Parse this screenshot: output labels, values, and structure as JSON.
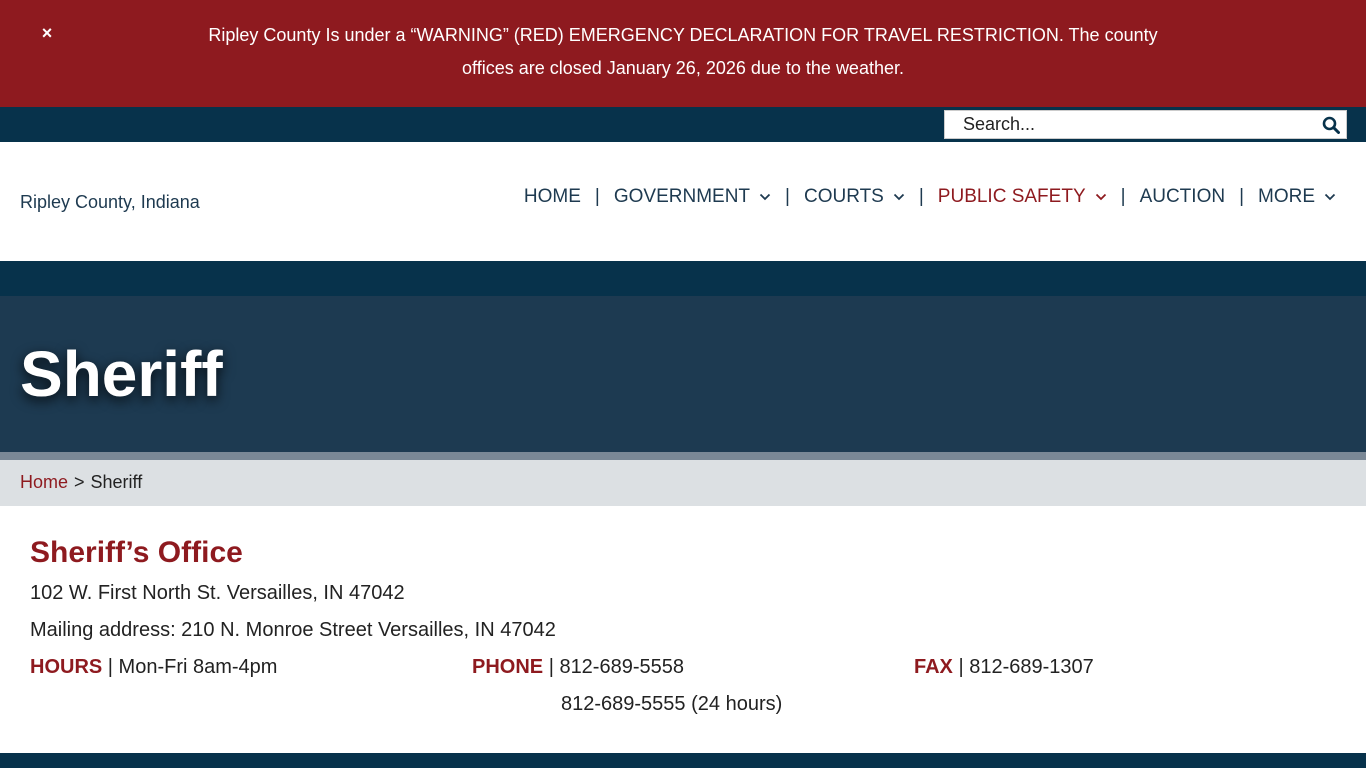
{
  "alert": {
    "close_label": "×",
    "message": "Ripley County Is under a “WARNING” (RED) EMERGENCY DECLARATION FOR TRAVEL RESTRICTION. The county offices are closed January 26, 2026 due to the weather."
  },
  "search": {
    "placeholder": "Search...",
    "icon": "search-icon"
  },
  "logo": {
    "alt": "Ripley County, Indiana"
  },
  "nav": {
    "items": [
      {
        "label": "HOME",
        "dropdown": false
      },
      {
        "label": "GOVERNMENT",
        "dropdown": true
      },
      {
        "label": "COURTS",
        "dropdown": true
      },
      {
        "label": "PUBLIC SAFETY",
        "dropdown": true,
        "active": true
      },
      {
        "label": "AUCTION",
        "dropdown": false
      },
      {
        "label": "MORE",
        "dropdown": true
      }
    ],
    "separator": "|"
  },
  "hero": {
    "title": "Sheriff"
  },
  "breadcrumb": {
    "home": "Home",
    "separator": ">",
    "current": "Sheriff"
  },
  "office": {
    "title": "Sheriff’s Office",
    "address": "102 W. First North St. Versailles, IN 47042",
    "mailing": "Mailing address: 210 N. Monroe Street Versailles, IN 47042",
    "hours_label": "HOURS",
    "hours_value": "| Mon-Fri 8am-4pm",
    "phone_label": "PHONE",
    "phone_value": "| 812-689-5558",
    "phone_value2": "812-689-5555 (24 hours)",
    "fax_label": "FAX",
    "fax_value": "| 812-689-1307"
  },
  "colors": {
    "alert_red": "#8e1a1f",
    "navy": "#07324b",
    "hero": "#1d3a51",
    "accent": "#8e1a1f"
  }
}
